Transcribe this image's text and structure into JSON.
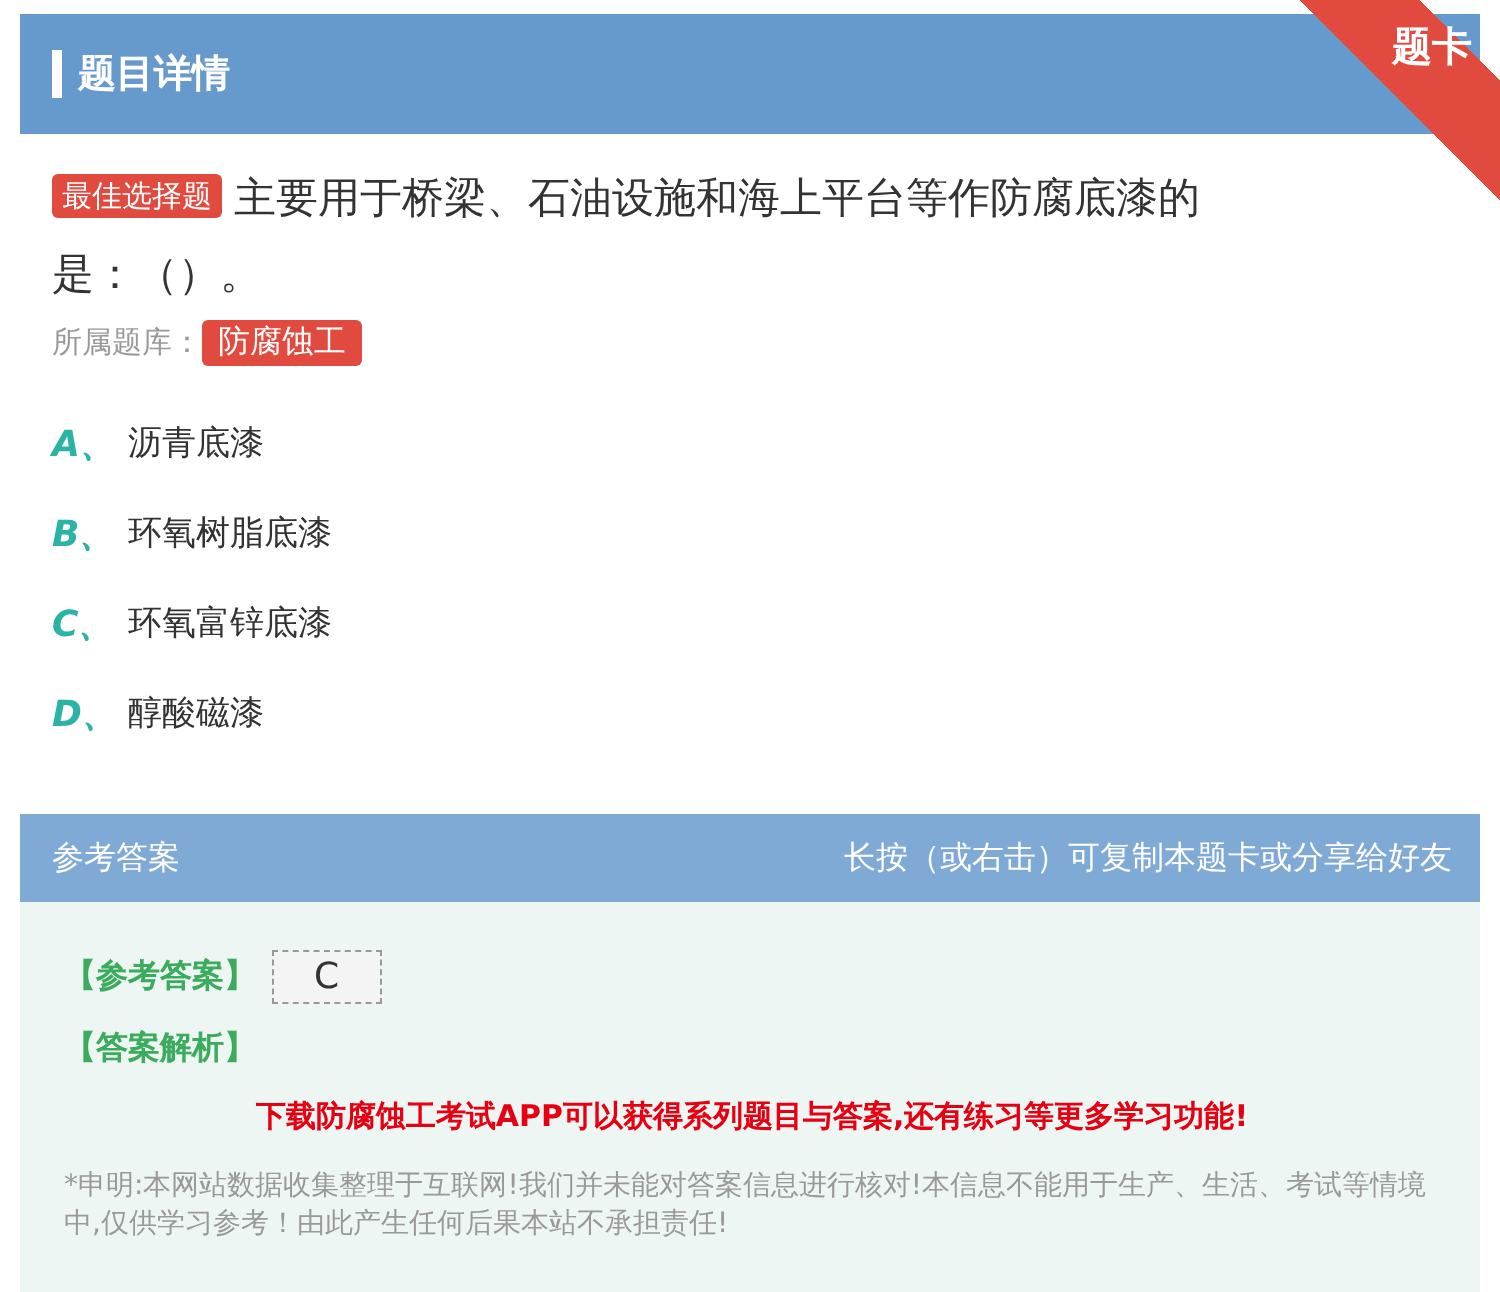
{
  "header": {
    "title": "题目详情"
  },
  "corner_ribbon": "题卡",
  "question": {
    "type_badge": "最佳选择题",
    "text_lines": [
      "主要用于桥梁、石油设施和海上平台等作防腐底漆的",
      "是：（）。"
    ],
    "bank_label": "所属题库：",
    "bank_tag": "防腐蚀工"
  },
  "options": [
    {
      "letter": "A、",
      "text": "沥青底漆"
    },
    {
      "letter": "B、",
      "text": "环氧树脂底漆"
    },
    {
      "letter": "C、",
      "text": "环氧富锌底漆"
    },
    {
      "letter": "D、",
      "text": "醇酸磁漆"
    }
  ],
  "answer_section": {
    "title": "参考答案",
    "hint": "长按（或右击）可复制本题卡或分享给好友",
    "answer_label": "【参考答案】",
    "answer": "C",
    "analysis_label": "【答案解析】",
    "promo": "下载防腐蚀工考试APP可以获得系列题目与答案,还有练习等更多学习功能!",
    "disclaimer": "*申明:本网站数据收集整理于互联网!我们并未能对答案信息进行核对!本信息不能用于生产、生活、考试等情境中,仅供学习参考！由此产生任何后果本站不承担责任!"
  }
}
